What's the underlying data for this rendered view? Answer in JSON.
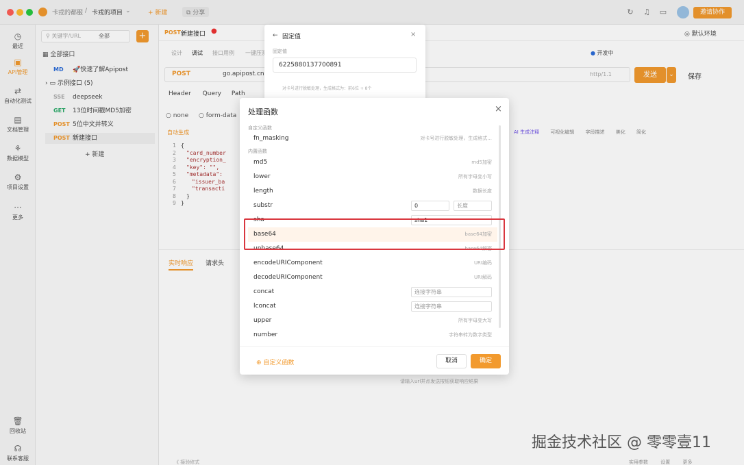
{
  "titlebar": {
    "breadcrumb_team": "卡戎的都服",
    "breadcrumb_sep": "/",
    "breadcrumb_project": "卡戎的项目",
    "new_label": "+ 新建",
    "share_label": "分享",
    "invite_label": "邀请协作"
  },
  "leftnav": {
    "items": [
      {
        "label": "最近",
        "icon": "clock-icon"
      },
      {
        "label": "API管理",
        "icon": "api-icon"
      },
      {
        "label": "自动化测试",
        "icon": "automation-icon"
      },
      {
        "label": "文档管理",
        "icon": "document-icon"
      },
      {
        "label": "数据模型",
        "icon": "model-icon"
      },
      {
        "label": "项目设置",
        "icon": "settings-icon"
      },
      {
        "label": "更多",
        "icon": "more-icon"
      },
      {
        "label": "回收站",
        "icon": "trash-icon"
      },
      {
        "label": "联系客服",
        "icon": "support-icon"
      }
    ]
  },
  "tree": {
    "search_placeholder": "关键字/URL",
    "filter_label": "全部",
    "all_label": "全部接口",
    "items": [
      {
        "method": "MD",
        "name": "🚀快速了解Apipost"
      },
      {
        "method": "",
        "name": "示例接口 (5)"
      },
      {
        "method": "SSE",
        "name": "deepseek"
      },
      {
        "method": "GET",
        "name": "13位时间戳MD5加密"
      },
      {
        "method": "POST",
        "name": "5位中文并转义"
      },
      {
        "method": "POST",
        "name": "新建接口"
      }
    ],
    "new_item": "+ 新建"
  },
  "main": {
    "tab_method": "POST",
    "tab_name": "新建接口",
    "env_label": "默认环境",
    "subtabs": [
      "设计",
      "调试",
      "接口用例",
      "一键压测"
    ],
    "status_label": "开发中",
    "method": "POST",
    "url": "go.apipost.cn",
    "http_version": "http/1.1",
    "send_label": "发送",
    "save_label": "保存",
    "request_tabs": [
      "Header",
      "Query",
      "Path",
      "Body"
    ],
    "body_types": [
      "none",
      "form-data"
    ],
    "auto_gen": "自动生成",
    "code_lines": [
      "{",
      "\"card_number",
      "\"encryption_",
      "\"key\": \"\",",
      "\"metadata\":",
      "\"issuer_ba",
      "\"transacti",
      "}",
      "}"
    ],
    "ai_tools": [
      "AI 生成注释",
      "可视化编辑",
      "字段描述",
      "美化",
      "简化"
    ],
    "response_tabs": [
      "实时响应",
      "请求头"
    ],
    "response_hint": "请输入url并点发送按钮获取响应结果",
    "footer_left": "《 接验修式",
    "footer_right": [
      "实用参数",
      "设置",
      "更多"
    ]
  },
  "popover": {
    "title": "固定值",
    "label": "固定值",
    "value": "6225880137700891",
    "desc": "对卡号进行脱敏处理，生成格式为：前6位 + 8个"
  },
  "modal": {
    "title": "处理函数",
    "custom_section": "自定义函数",
    "builtin_section": "内置函数",
    "functions": [
      {
        "name": "fn_masking",
        "desc": "对卡号进行脱敏处理，生成格式..."
      },
      {
        "name": "md5",
        "desc": "md5加密"
      },
      {
        "name": "lower",
        "desc": "所有字母变小写"
      },
      {
        "name": "length",
        "desc": "数据长度"
      },
      {
        "name": "substr",
        "input1": "0",
        "input2": "长度"
      },
      {
        "name": "sha",
        "select": "sha1"
      },
      {
        "name": "base64",
        "desc": "base64加密"
      },
      {
        "name": "unbase64",
        "desc": "base64解密"
      },
      {
        "name": "encodeURIComponent",
        "desc": "URI编码"
      },
      {
        "name": "decodeURIComponent",
        "desc": "URI解码"
      },
      {
        "name": "concat",
        "placeholder": "连接字符串"
      },
      {
        "name": "lconcat",
        "placeholder": "连接字符串"
      },
      {
        "name": "upper",
        "desc": "所有字母变大写"
      },
      {
        "name": "number",
        "desc": "字符串转为数字类型"
      }
    ],
    "custom_fn_link": "自定义函数",
    "cancel_label": "取消",
    "confirm_label": "确定"
  },
  "watermark": "掘金技术社区 @ 零零壹11"
}
